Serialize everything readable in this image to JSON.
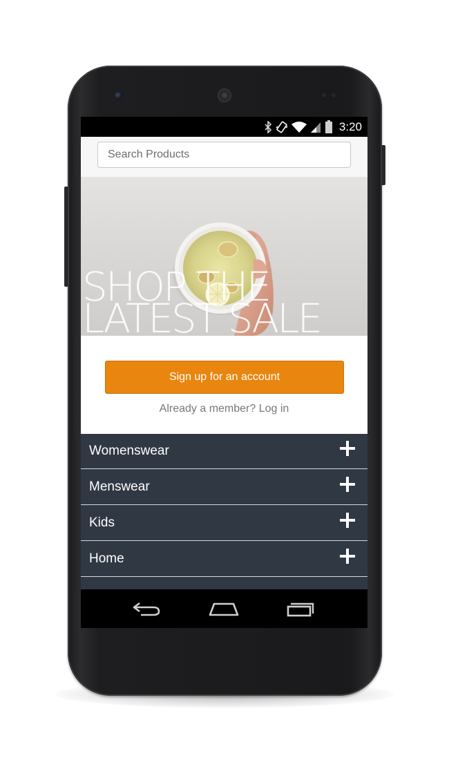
{
  "status_bar": {
    "time": "3:20",
    "icons": [
      "bluetooth-icon",
      "vibrate-icon",
      "wifi-icon",
      "signal-icon",
      "battery-icon"
    ]
  },
  "search": {
    "placeholder": "Search Products",
    "value": ""
  },
  "hero": {
    "line1": "SHOP THE",
    "line2": "LATEST SALE"
  },
  "cta": {
    "signup_label": "Sign up for an account",
    "member_prompt": "Already a member?",
    "login_label": "Log in"
  },
  "categories": [
    {
      "label": "Womenswear",
      "icon": "plus-icon"
    },
    {
      "label": "Menswear",
      "icon": "plus-icon"
    },
    {
      "label": "Kids",
      "icon": "plus-icon"
    },
    {
      "label": "Home",
      "icon": "plus-icon"
    }
  ],
  "nav": {
    "icons": [
      "back-icon",
      "home-icon",
      "recent-apps-icon"
    ]
  },
  "colors": {
    "accent": "#e8860f",
    "category_bg": "#303844",
    "search_bar_bg": "#f7f7f7"
  }
}
